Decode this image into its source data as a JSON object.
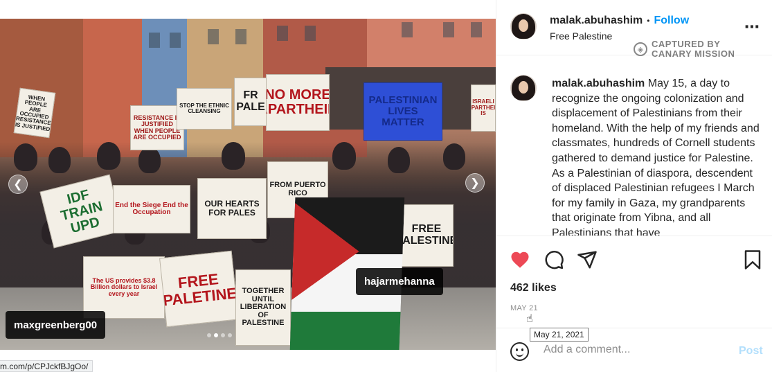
{
  "post": {
    "username": "malak.abuhashim",
    "follow_label": "Follow",
    "separator": "•",
    "location": "Free Palestine",
    "more_icon": "more-horizontal-icon",
    "watermark": "CAPTURED BY CANARY MISSION",
    "watermark_line1": "CAPTURED BY",
    "watermark_line2": "CANARY MISSION",
    "caption_text": "May 15, a day to recognize the ongoing colonization and displacement of Palestinians from their homeland. With the help of my friends and classmates, hundreds of Cornell students gathered to demand justice for Palestine. As a Palestinian of diaspora, descendent of displaced Palestinian refugees I March for my family in Gaza, my grandparents that originate from Yibna, and all Palestinians that have",
    "likes": "462 likes",
    "date": "MAY 21",
    "date_tooltip": "May 21, 2021",
    "comment_placeholder": "Add a comment...",
    "post_label": "Post",
    "liked": true,
    "like_color": "#ed4956"
  },
  "media": {
    "tags": [
      "maxgreenberg00",
      "hajarmehanna"
    ],
    "slide_count": 4,
    "active_slide": 2,
    "link_preview": "m.com/p/CPJckfBJgOo/",
    "signs": {
      "no_more_apartheid": "NO MORE APARTHEID",
      "palestinian_lives_matter": "PALESTINIAN LIVES MATTER",
      "free_palestine": "FREE PALESTINE",
      "free_paletine": "FREE PALETINE",
      "idf_train": "IDF TRAIN UPD",
      "our_hearts": "OUR HEARTS FOR PALES",
      "resistance": "RESISTANCE IS JUSTIFIED WHEN PEOPLE ARE OCCUPIED",
      "when_occupied": "WHEN PEOPLE ARE OCCUPIED RESISTANCE IS JUSTIFIED",
      "end": "End the Siege End the Occupation",
      "us_provides": "The US provides $3.8 Billion dollars to Israel every year",
      "together": "TOGETHER UNTIL LIBERATION OF PALESTINE",
      "from_puerto_rico": "FROM PUERTO RICO",
      "stop_ethnic": "STOP THE ETHNIC CLEANSING",
      "free_palestine_right": "FREE PALESTINE",
      "israeli_apartheid": "ISRAELI APARTHEID IS",
      "fr": "FR PALE"
    }
  },
  "colors": {
    "follow": "#0095f6",
    "post_disabled": "#b2dffc",
    "secondary_text": "#8e8e8e",
    "flag_black": "#1b1b1b",
    "flag_white": "#f5f5f5",
    "flag_green": "#1f7a3a",
    "flag_red": "#c62a2a"
  }
}
